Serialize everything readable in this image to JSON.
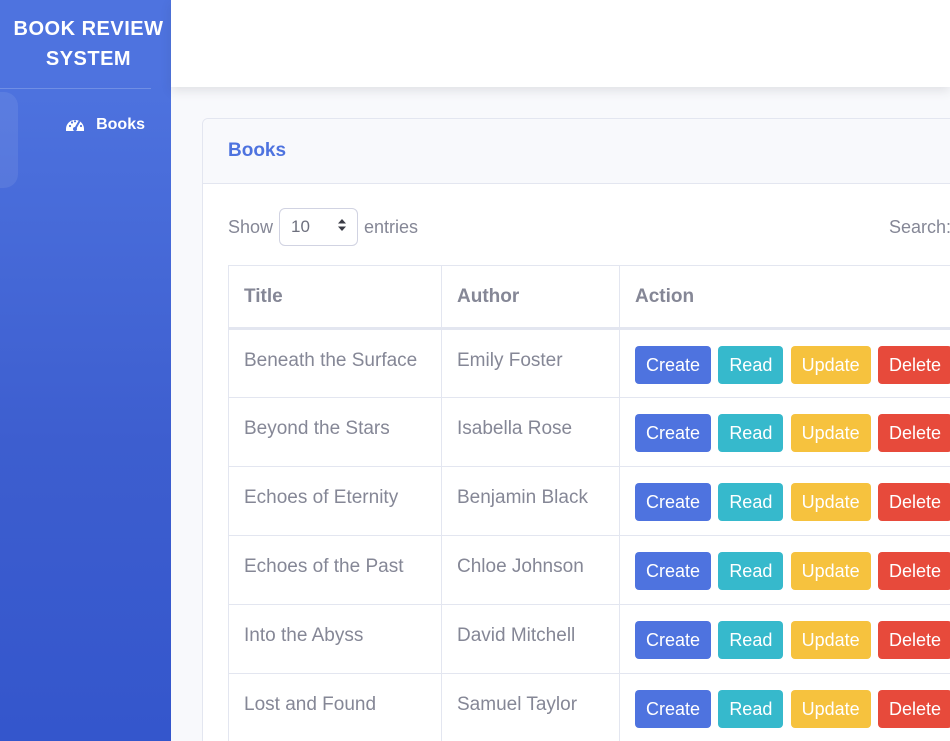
{
  "brand": {
    "line1": "BOOK REVIEW",
    "line2": "SYSTEM"
  },
  "sidebar": {
    "items": [
      {
        "label": "Books",
        "icon": "tachometer-icon"
      }
    ]
  },
  "card": {
    "title": "Books"
  },
  "controls": {
    "show_label": "Show",
    "entries_value": "10",
    "entries_label": "entries",
    "search_label": "Search:"
  },
  "table": {
    "headers": {
      "title": "Title",
      "author": "Author",
      "action": "Action"
    },
    "rows": [
      {
        "title": "Beneath the Surface",
        "author": "Emily Foster"
      },
      {
        "title": "Beyond the Stars",
        "author": "Isabella Rose"
      },
      {
        "title": "Echoes of Eternity",
        "author": "Benjamin Black"
      },
      {
        "title": "Echoes of the Past",
        "author": "Chloe Johnson"
      },
      {
        "title": "Into the Abyss",
        "author": "David Mitchell"
      },
      {
        "title": "Lost and Found",
        "author": "Samuel Taylor"
      }
    ]
  },
  "buttons": {
    "create": "Create",
    "read": "Read",
    "update": "Update",
    "delete": "Delete"
  },
  "colors": {
    "primary": "#4e73df",
    "info": "#36b9cc",
    "warning": "#f6c23e",
    "danger": "#e74a3b",
    "text": "#858796"
  }
}
